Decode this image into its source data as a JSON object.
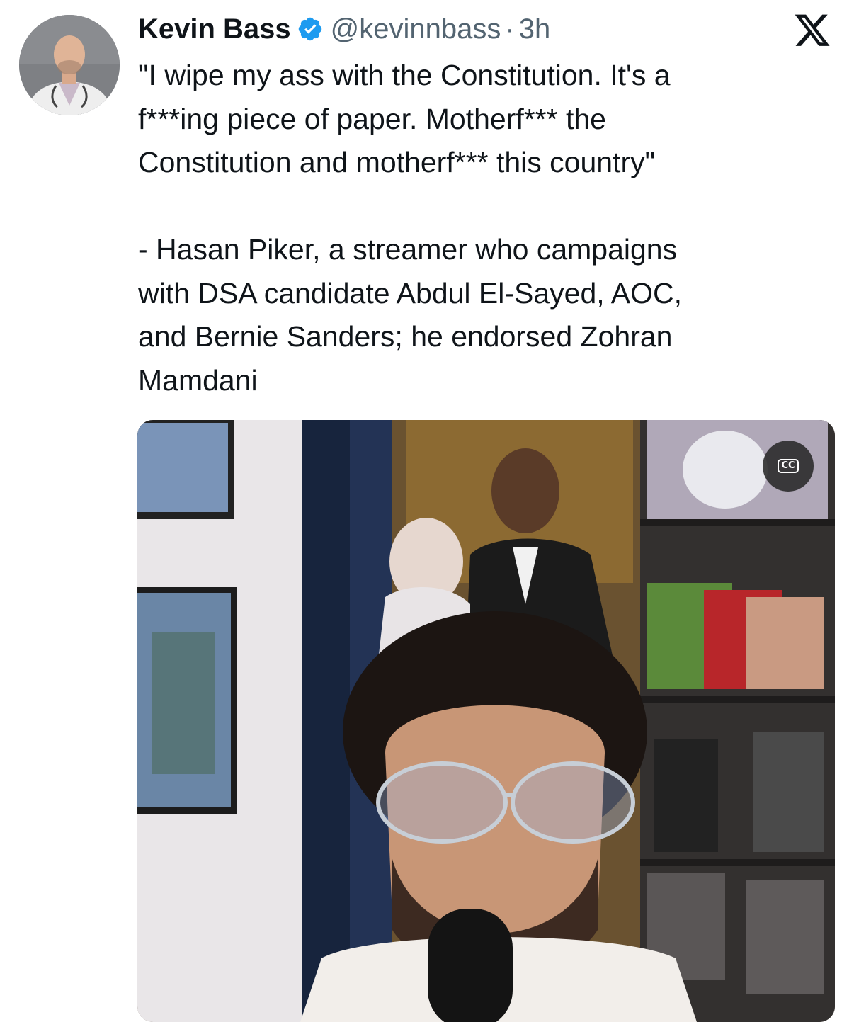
{
  "tweet": {
    "author_name": "Kevin Bass",
    "handle": "@kevinnbass",
    "separator": "·",
    "time": "3h",
    "verified": true,
    "text_lines": [
      "\"I wipe my ass with the Constitution. It's a",
      "f***ing piece of paper. Motherf*** the",
      "Constitution and motherf*** this country\"",
      "- Hasan Piker, a streamer who campaigns",
      "with DSA candidate Abdul El-Sayed, AOC,",
      "and Bernie Sanders; he endorsed Zohran",
      "Mamdani"
    ]
  },
  "media": {
    "type": "video",
    "cc_label": "CC"
  },
  "colors": {
    "text": "#0f1419",
    "secondary": "#536471",
    "verified": "#1d9bf0"
  },
  "icons": {
    "verified": "verified-badge-icon",
    "x_logo": "x-logo-icon",
    "cc": "closed-captions-icon"
  }
}
